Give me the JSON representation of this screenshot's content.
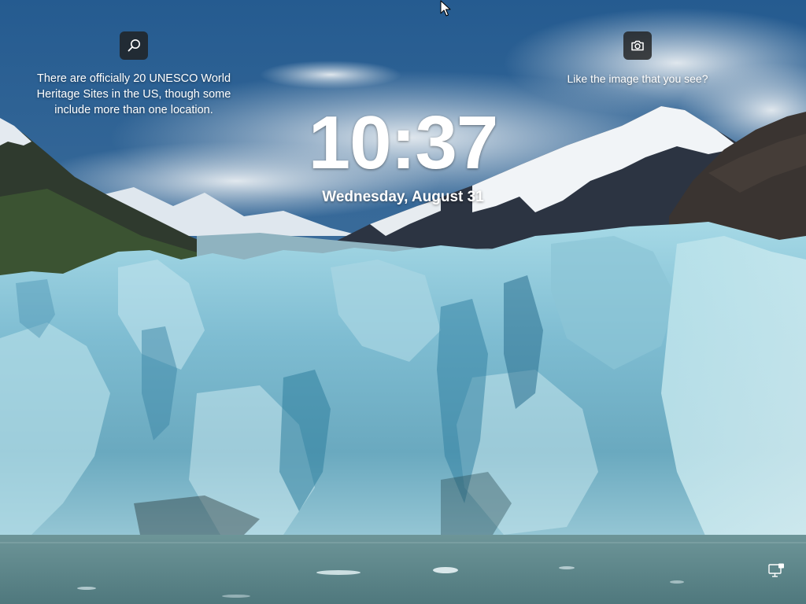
{
  "lock_screen": {
    "time": "10:37",
    "date": "Wednesday, August 31"
  },
  "fact_widget": {
    "icon": "search-icon",
    "text": "There are officially 20 UNESCO World Heritage Sites in the US, though some include more than one location."
  },
  "spotlight_widget": {
    "icon": "camera-icon",
    "text": "Like the image that you see?"
  },
  "system_tray": {
    "icon": "network-icon"
  },
  "colors": {
    "sky": "#2c5a86",
    "glacier": "#8fc6d6",
    "water": "#5b8489",
    "widget_bg": "#202020",
    "text": "#ffffff"
  }
}
